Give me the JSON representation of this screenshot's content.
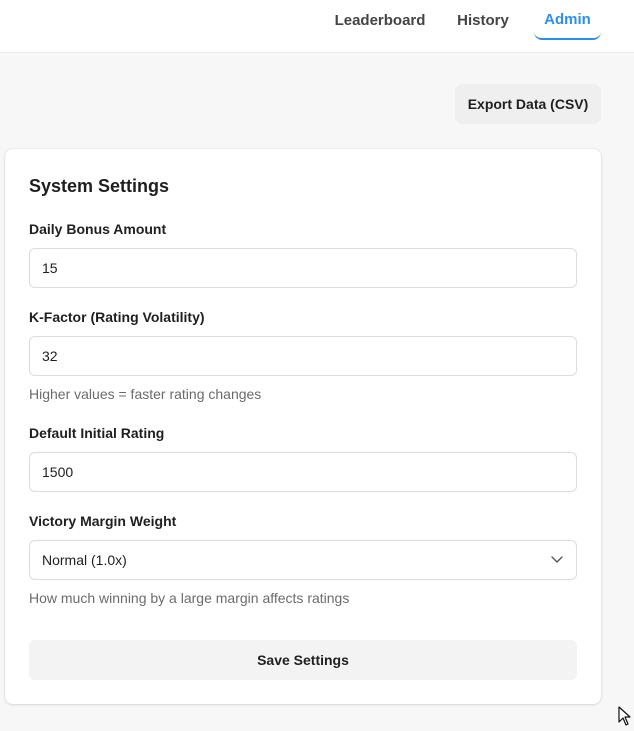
{
  "nav": {
    "tabs": [
      {
        "label": "Leaderboard",
        "active": false
      },
      {
        "label": "History",
        "active": false
      },
      {
        "label": "Admin",
        "active": true
      }
    ],
    "accent": "#2f8fe8"
  },
  "actions": {
    "export_label": "Export Data (CSV)"
  },
  "settings": {
    "title": "System Settings",
    "daily_bonus": {
      "label": "Daily Bonus Amount",
      "value": "15"
    },
    "k_factor": {
      "label": "K-Factor (Rating Volatility)",
      "value": "32",
      "helper": "Higher values = faster rating changes"
    },
    "initial_rating": {
      "label": "Default Initial Rating",
      "value": "1500"
    },
    "victory_margin": {
      "label": "Victory Margin Weight",
      "selected": "Normal (1.0x)",
      "helper": "How much winning by a large margin affects ratings"
    },
    "save_label": "Save Settings"
  },
  "icons": {
    "select_chevron": "chevron-down-icon",
    "mouse_cursor": "mouse-pointer-icon"
  }
}
